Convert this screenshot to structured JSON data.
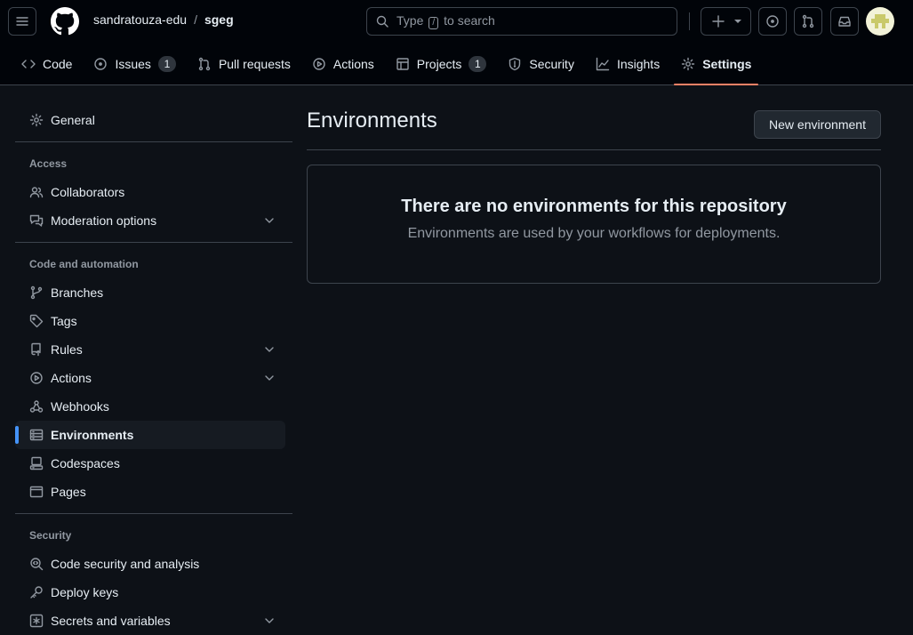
{
  "header": {
    "owner": "sandratouza-edu",
    "separator": "/",
    "repo": "sgeg",
    "search": {
      "prefix": "Type",
      "key": "/",
      "suffix": "to search"
    },
    "icons": [
      "hamburger-icon",
      "github-logo-icon",
      "search-icon",
      "plus-icon",
      "triangle-down-icon",
      "issue-opened-icon",
      "git-pull-request-icon",
      "inbox-icon"
    ]
  },
  "tabs": [
    {
      "label": "Code",
      "icon": "code-icon"
    },
    {
      "label": "Issues",
      "icon": "issue-opened-icon",
      "count": "1"
    },
    {
      "label": "Pull requests",
      "icon": "git-pull-request-icon"
    },
    {
      "label": "Actions",
      "icon": "play-icon"
    },
    {
      "label": "Projects",
      "icon": "table-icon",
      "count": "1"
    },
    {
      "label": "Security",
      "icon": "shield-icon"
    },
    {
      "label": "Insights",
      "icon": "graph-icon"
    },
    {
      "label": "Settings",
      "icon": "gear-icon",
      "selected": true
    }
  ],
  "sidebar": {
    "general": "General",
    "access_heading": "Access",
    "access": [
      {
        "label": "Collaborators",
        "icon": "people-icon"
      },
      {
        "label": "Moderation options",
        "icon": "comment-discussion-icon",
        "expandable": true
      }
    ],
    "code_heading": "Code and automation",
    "code": [
      {
        "label": "Branches",
        "icon": "git-branch-icon"
      },
      {
        "label": "Tags",
        "icon": "tag-icon"
      },
      {
        "label": "Rules",
        "icon": "repo-push-icon",
        "expandable": true
      },
      {
        "label": "Actions",
        "icon": "play-icon",
        "expandable": true
      },
      {
        "label": "Webhooks",
        "icon": "webhook-icon"
      },
      {
        "label": "Environments",
        "icon": "server-icon",
        "selected": true
      },
      {
        "label": "Codespaces",
        "icon": "codespaces-icon"
      },
      {
        "label": "Pages",
        "icon": "browser-icon"
      }
    ],
    "security_heading": "Security",
    "security": [
      {
        "label": "Code security and analysis",
        "icon": "codescan-icon"
      },
      {
        "label": "Deploy keys",
        "icon": "key-icon"
      },
      {
        "label": "Secrets and variables",
        "icon": "key-asterisk-icon",
        "expandable": true
      }
    ]
  },
  "main": {
    "title": "Environments",
    "new_button": "New environment",
    "blank_title": "There are no environments for this repository",
    "blank_text": "Environments are used by your workflows for deployments."
  },
  "colors": {
    "background": "#0d1117",
    "header_bg": "#010409",
    "border": "#3d444d",
    "tab_underline": "#f78166",
    "nav_accent": "#4493f8",
    "muted_text": "#9198a1"
  }
}
